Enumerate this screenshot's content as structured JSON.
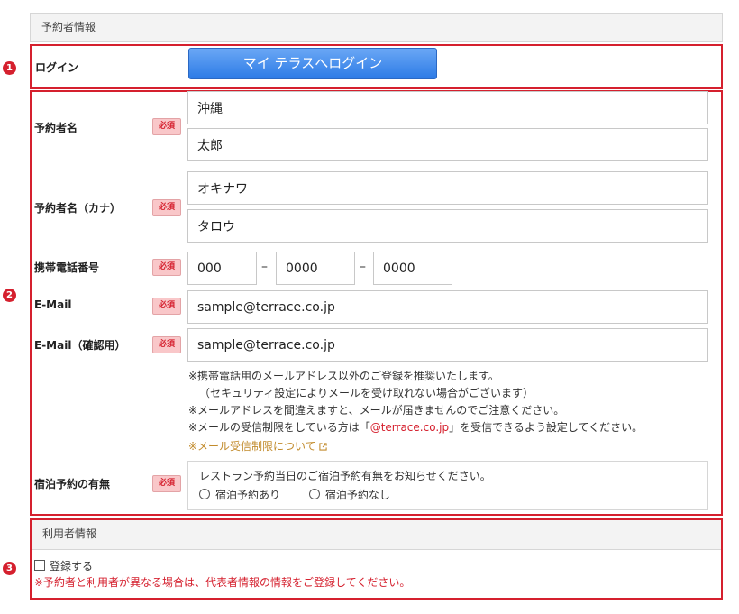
{
  "section_reserver": {
    "title": "予約者情報"
  },
  "markers": {
    "one": "1",
    "two": "2",
    "three": "3"
  },
  "login": {
    "label": "ログイン",
    "button_label": "マイ テラスへログイン"
  },
  "required_badge": "必須",
  "fields": {
    "name": {
      "label": "予約者名",
      "last": "沖縄",
      "first": "太郎"
    },
    "name_kana": {
      "label": "予約者名（カナ）",
      "last": "オキナワ",
      "first": "タロウ"
    },
    "phone": {
      "label": "携帯電話番号",
      "part1": "000",
      "part2": "0000",
      "part3": "0000",
      "separator": "–"
    },
    "email": {
      "label": "E-Mail",
      "value": "sample@terrace.co.jp"
    },
    "email_confirm": {
      "label": "E-Mail（確認用）",
      "value": "sample@terrace.co.jp"
    }
  },
  "notes": {
    "line1": "※携帯電話用のメールアドレス以外のご登録を推奨いたします。",
    "line2": "（セキュリティ設定によりメールを受け取れない場合がございます）",
    "line3": "※メールアドレスを間違えますと、メールが届きませんのでご注意ください。",
    "line4_pre": "※メールの受信制限をしている方は「",
    "line4_domain": "@terrace.co.jp",
    "line4_post": "」を受信できるよう設定してください。",
    "link": "※メール受信制限について"
  },
  "stay": {
    "label": "宿泊予約の有無",
    "question": "レストラン予約当日のご宿泊予約有無をお知らせください。",
    "option_yes": "宿泊予約あり",
    "option_no": "宿泊予約なし"
  },
  "section_user": {
    "title": "利用者情報"
  },
  "register": {
    "checkbox_label": "登録する",
    "warning": "※予約者と利用者が異なる場合は、代表者情報の情報をご登録してください。"
  },
  "colors": {
    "accent_red": "#d5202e",
    "button_blue": "#3b86ea",
    "link_gold": "#c28b2c"
  }
}
